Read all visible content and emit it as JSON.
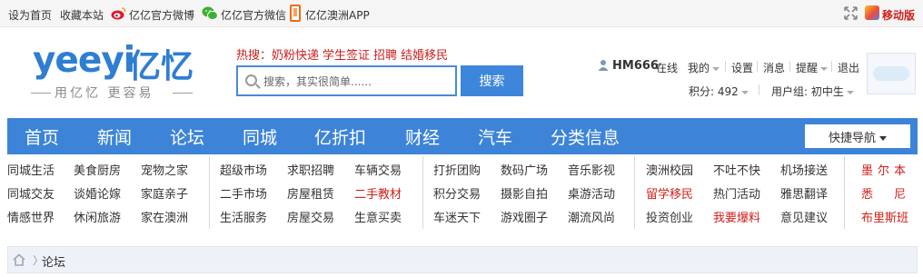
{
  "topbar": {
    "set_home": "设为首页",
    "bookmark": "收藏本站",
    "weibo": "亿亿官方微博",
    "wechat": "亿亿官方微信",
    "app": "亿亿澳洲APP",
    "mobile": "移动版"
  },
  "logo": {
    "en": "yeeyi",
    "cn": "亿忆",
    "slogan": "用亿忆 更容易"
  },
  "hot": {
    "label": "热搜：",
    "items": [
      "奶粉快递",
      "学生签证",
      "招聘",
      "结婚移民"
    ]
  },
  "search": {
    "placeholder": "搜索，其实很简单......",
    "button": "搜索"
  },
  "user": {
    "name": "HM666",
    "status": "在线",
    "mine": "我的",
    "settings": "设置",
    "messages": "消息",
    "remind": "提醒",
    "logout": "退出",
    "points": "积分: 492",
    "group": "用户组: 初中生"
  },
  "nav": {
    "items": [
      "首页",
      "新闻",
      "论坛",
      "同城",
      "亿折扣",
      "财经",
      "汽车",
      "分类信息"
    ],
    "quick": "快捷导航"
  },
  "links": {
    "col1": [
      "同城生活",
      "美食厨房",
      "宠物之家",
      "同城交友",
      "谈婚论嫁",
      "家庭亲子",
      "情感世界",
      "休闲旅游",
      "家在澳洲"
    ],
    "col2": [
      "超级市场",
      "求职招聘",
      "车辆交易",
      "二手市场",
      "房屋租赁",
      "二手教材",
      "生活服务",
      "房屋交易",
      "生意买卖"
    ],
    "col3": [
      "打折团购",
      "数码广场",
      "音乐影视",
      "积分交易",
      "摄影自拍",
      "桌游活动",
      "车迷天下",
      "游戏圈子",
      "潮流风尚"
    ],
    "col4": [
      "澳洲校园",
      "不吐不快",
      "机场接送",
      "留学移民",
      "热门活动",
      "雅思翻译",
      "投资创业",
      "我要爆料",
      "意见建议"
    ],
    "cities": [
      "墨",
      "尔",
      "本",
      "悉",
      "尼",
      "布里斯班"
    ]
  },
  "colors": {
    "brand": "#3d84d8",
    "red": "#d0201b"
  },
  "breadcrumb": {
    "current": "论坛"
  }
}
